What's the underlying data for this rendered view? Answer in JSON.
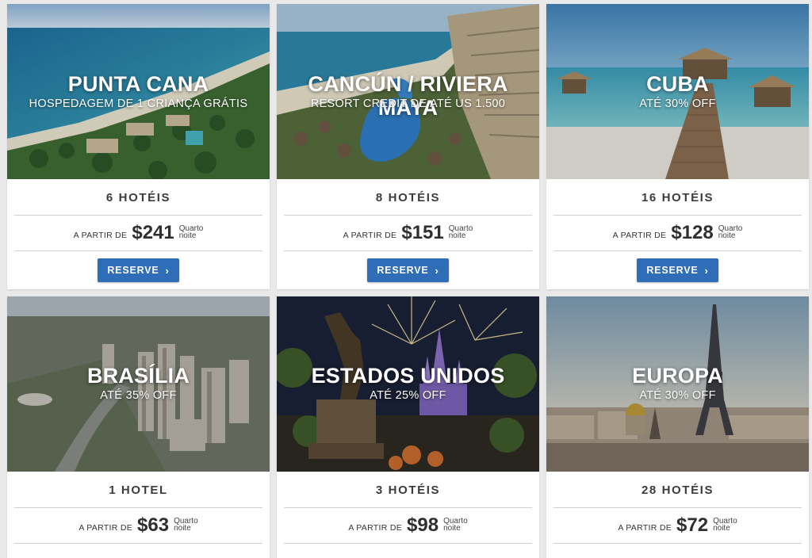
{
  "cards": [
    {
      "name": "PUNTA CANA",
      "offer": "HOSPEDAGEM DE 1 CRIANÇA GRÁTIS",
      "hotels": "6 HOTÉIS",
      "from": "A PARTIR DE",
      "price": "$241",
      "unit1": "Quarto",
      "unit2": "noite",
      "button": "RESERVE"
    },
    {
      "name": "CANCÚN / RIVIERA MAYA",
      "offer": "RESORT CREDIT DE ATÉ US 1.500",
      "hotels": "8 HOTÉIS",
      "from": "A PARTIR DE",
      "price": "$151",
      "unit1": "Quarto",
      "unit2": "noite",
      "button": "RESERVE"
    },
    {
      "name": "CUBA",
      "offer": "ATÉ 30% OFF",
      "hotels": "16 HOTÉIS",
      "from": "A PARTIR DE",
      "price": "$128",
      "unit1": "Quarto",
      "unit2": "noite",
      "button": "RESERVE"
    },
    {
      "name": "BRASÍLIA",
      "offer": "ATÉ 35% OFF",
      "hotels": "1 HOTEL",
      "from": "A PARTIR DE",
      "price": "$63",
      "unit1": "Quarto",
      "unit2": "noite"
    },
    {
      "name": "ESTADOS UNIDOS",
      "offer": "ATÉ 25% OFF",
      "hotels": "3 HOTÉIS",
      "from": "A PARTIR DE",
      "price": "$98",
      "unit1": "Quarto",
      "unit2": "noite"
    },
    {
      "name": "EUROPA",
      "offer": "ATÉ 30% OFF",
      "hotels": "28 HOTÉIS",
      "from": "A PARTIR DE",
      "price": "$72",
      "unit1": "Quarto",
      "unit2": "noite"
    }
  ],
  "colors": {
    "button": "#2f6db8",
    "background": "#e9e9ea"
  },
  "icons": {
    "button_arrow": "chevron-right-icon"
  },
  "button_glyph": "›"
}
